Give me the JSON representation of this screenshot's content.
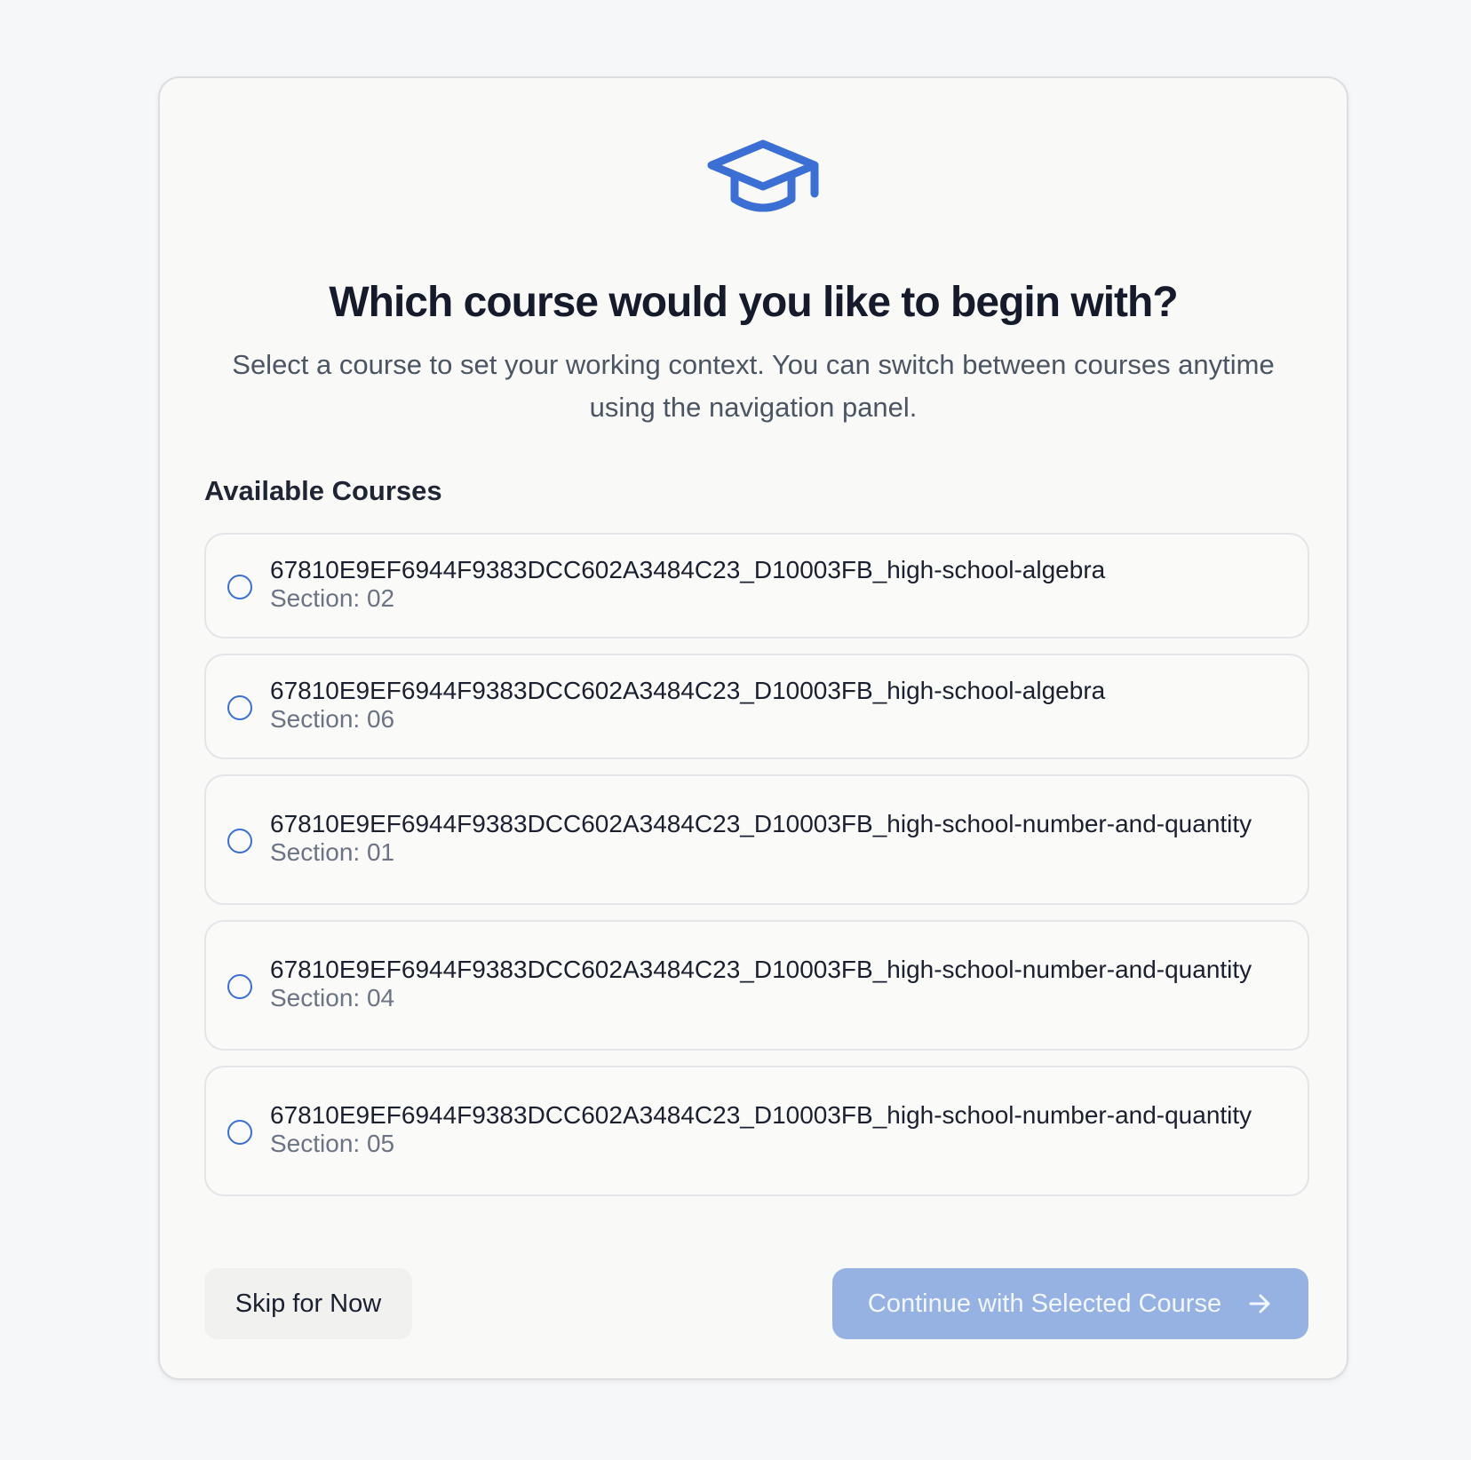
{
  "heading": {
    "title": "Which course would you like to begin with?",
    "subtitle": "Select a course to set your working context. You can switch between courses anytime using the navigation panel.",
    "icon": "graduation-cap-icon"
  },
  "available_label": "Available Courses",
  "courses": [
    {
      "name": "67810E9EF6944F9383DCC602A3484C23_D10003FB_high-school-algebra",
      "section": "Section: 02",
      "selected": false
    },
    {
      "name": "67810E9EF6944F9383DCC602A3484C23_D10003FB_high-school-algebra",
      "section": "Section: 06",
      "selected": false
    },
    {
      "name": "67810E9EF6944F9383DCC602A3484C23_D10003FB_high-school-number-and-quantity",
      "section": "Section: 01",
      "selected": false
    },
    {
      "name": "67810E9EF6944F9383DCC602A3484C23_D10003FB_high-school-number-and-quantity",
      "section": "Section: 04",
      "selected": false
    },
    {
      "name": "67810E9EF6944F9383DCC602A3484C23_D10003FB_high-school-number-and-quantity",
      "section": "Section: 05",
      "selected": false
    }
  ],
  "actions": {
    "skip_label": "Skip for Now",
    "continue_label": "Continue with Selected Course",
    "continue_icon": "arrow-right-icon",
    "continue_disabled": true
  },
  "colors": {
    "accent": "#3b6fd4",
    "continue_disabled_bg": "#96b2e2",
    "title": "#161b2b",
    "subtitle": "#4b5563",
    "page_bg": "#f6f7f8"
  }
}
